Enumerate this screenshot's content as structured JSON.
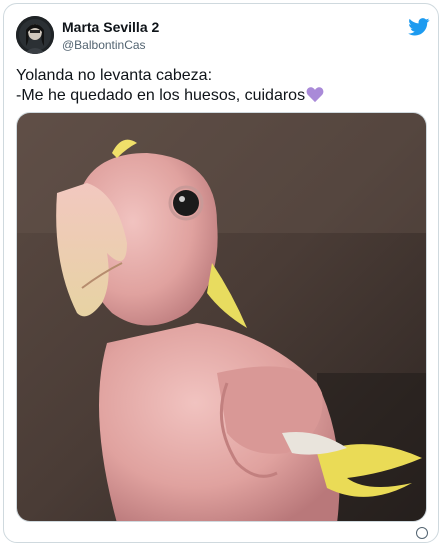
{
  "author": {
    "display_name": "Marta Sevilla 2",
    "handle": "@BalbontinCas"
  },
  "tweet": {
    "line1": "Yolanda no levanta cabeza:",
    "line2": "-Me he quedado en los huesos, cuidaros",
    "emoji": "purple-heart-icon"
  },
  "media": {
    "subject": "plucked parrot photo"
  },
  "icons": {
    "platform": "twitter-bird-icon",
    "more": "info-circle-icon"
  },
  "colors": {
    "text": "#0f1419",
    "secondary": "#536471",
    "twitter_blue": "#1d9bf0",
    "heart": "#a98ad8"
  }
}
